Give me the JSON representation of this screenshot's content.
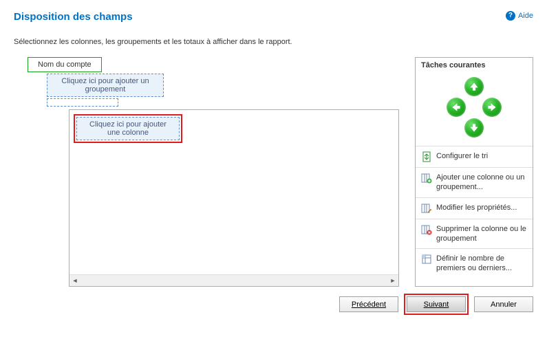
{
  "header": {
    "title": "Disposition des champs",
    "help_label": "Aide"
  },
  "instruction": "Sélectionnez les colonnes, les groupements et les totaux à afficher dans le rapport.",
  "layout": {
    "account_label": "Nom du compte",
    "add_grouping_label": "Cliquez ici pour ajouter un groupement",
    "add_column_label": "Cliquez ici pour ajouter une colonne"
  },
  "tasks": {
    "title": "Tâches courantes",
    "configure_sort": "Configurer le tri",
    "add_column_or_group": "Ajouter une colonne ou un groupement...",
    "modify_properties": "Modifier les propriétés...",
    "delete_column_or_group": "Supprimer la colonne ou le groupement",
    "define_firsts_lasts": "Définir le nombre de premiers ou derniers..."
  },
  "footer": {
    "prev": "Précédent",
    "next": "Suivant",
    "cancel": "Annuler"
  }
}
